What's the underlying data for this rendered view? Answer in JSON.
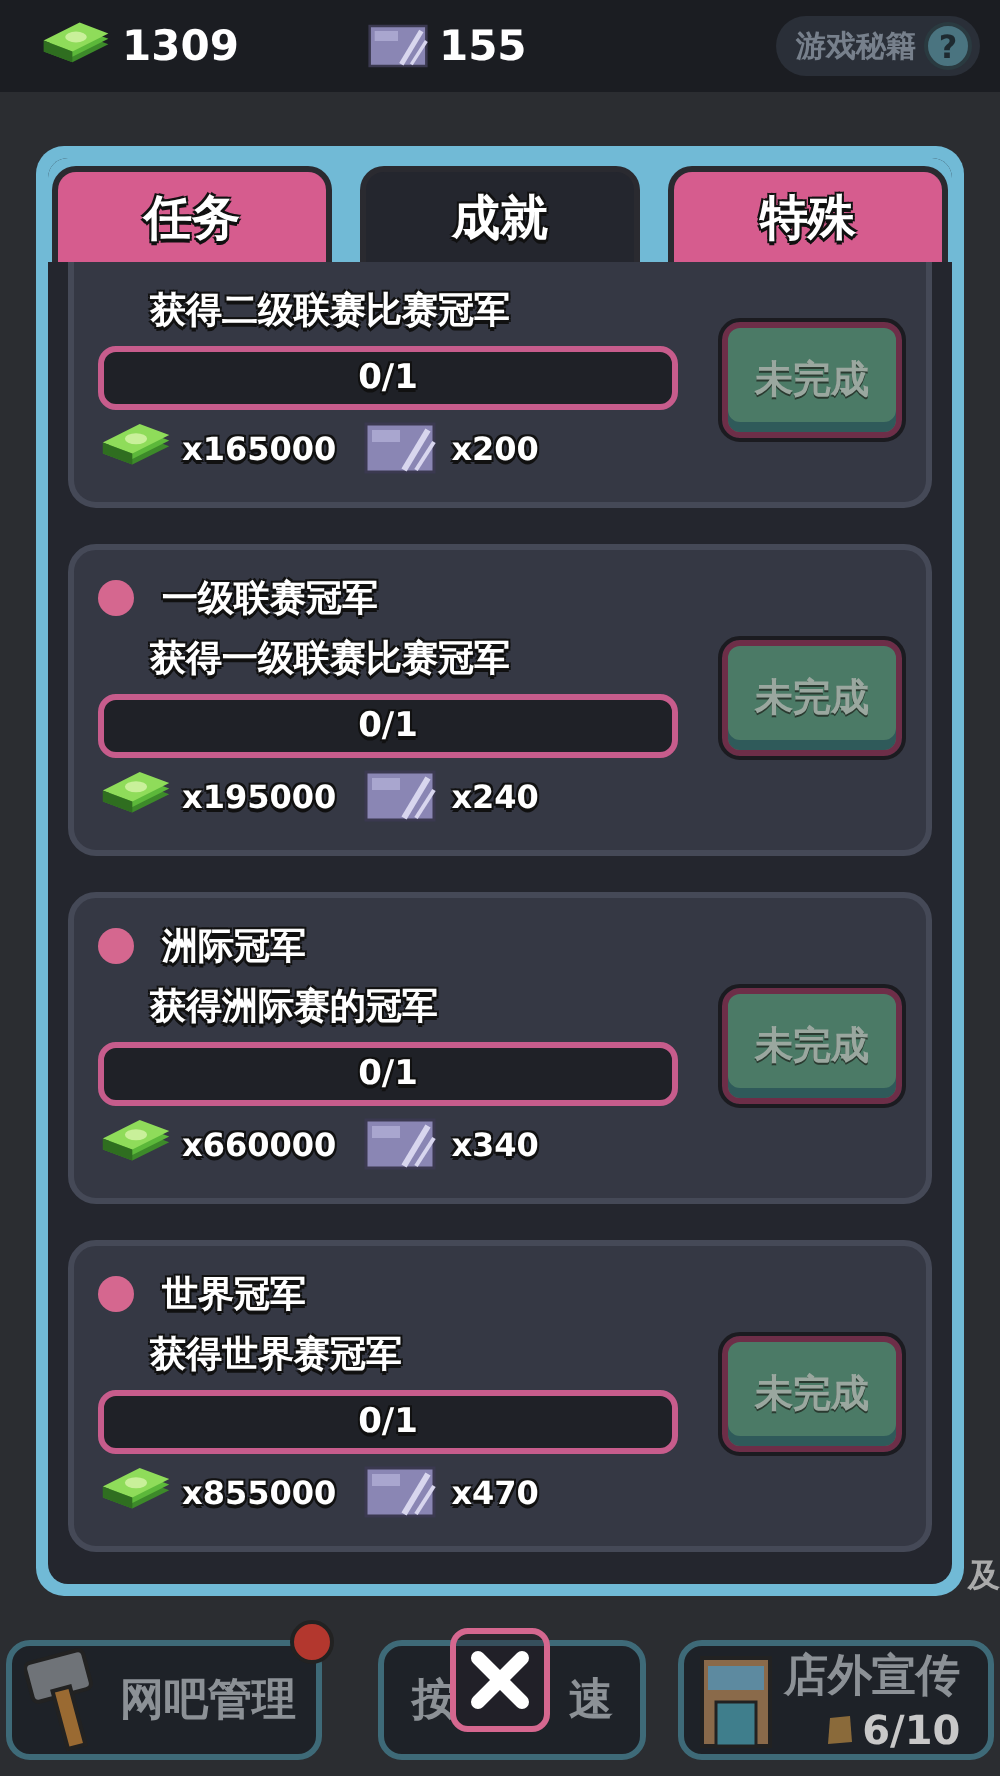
{
  "hud": {
    "cash": "1309",
    "vip": "155",
    "help_button": "游戏秘籍",
    "help_icon": "?"
  },
  "tabs": [
    {
      "label": "任务",
      "selected": false
    },
    {
      "label": "成就",
      "selected": true
    },
    {
      "label": "特殊",
      "selected": false
    }
  ],
  "achievements": [
    {
      "description": "获得二级联赛比赛冠军",
      "progress": "0/1",
      "level": 0,
      "cash_reward": "x165000",
      "vip_reward": "x200",
      "status": "未完成",
      "completed": false
    },
    {
      "title": "一级联赛冠军",
      "description": "获得一级联赛比赛冠军",
      "progress": "0/1",
      "level": 0,
      "cash_reward": "x195000",
      "vip_reward": "x240",
      "status": "未完成",
      "completed": false
    },
    {
      "title": "洲际冠军",
      "description": "获得洲际赛的冠军",
      "progress": "0/1",
      "level": 0,
      "cash_reward": "x660000",
      "vip_reward": "x340",
      "status": "未完成",
      "completed": false
    },
    {
      "title": "世界冠军",
      "description": "获得世界赛冠军",
      "progress": "0/1",
      "level": 0,
      "cash_reward": "x855000",
      "vip_reward": "x470",
      "status": "未完成",
      "completed": false
    }
  ],
  "bottom_bar": [
    {
      "kind": "manage",
      "label": "网吧管理",
      "badge": true
    },
    {
      "kind": "speed",
      "label_parts": [
        "按",
        "速"
      ]
    },
    {
      "kind": "promo",
      "label": "店外宣传",
      "count": "6/10"
    }
  ],
  "edge_text": "及"
}
